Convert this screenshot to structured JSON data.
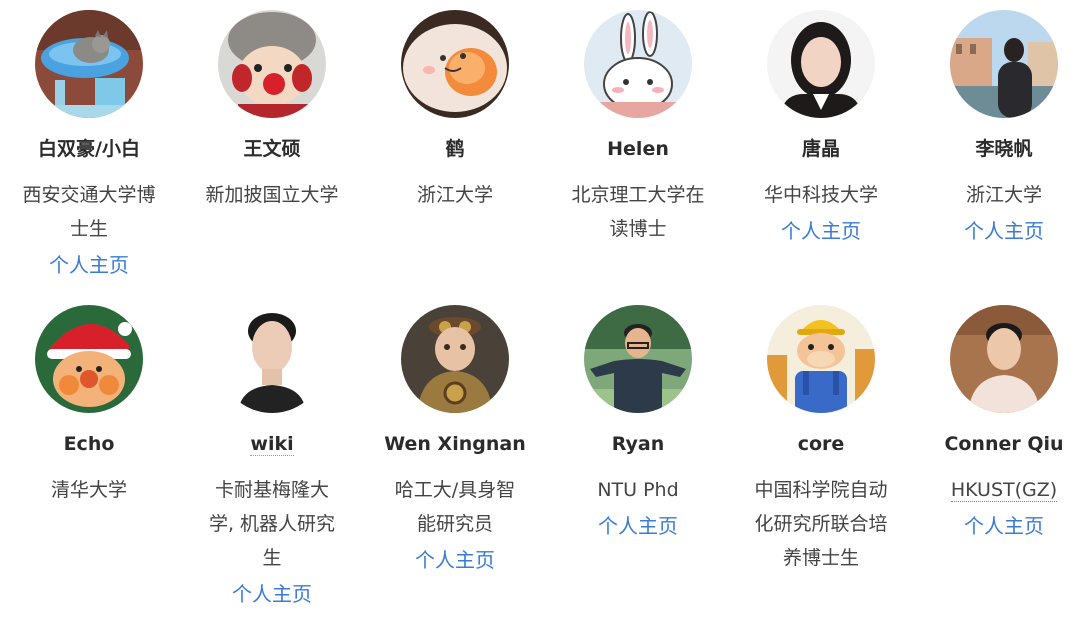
{
  "colors": {
    "link": "#3a7bd5",
    "name": "#2b2b2b",
    "desc": "#444444",
    "background": "#ffffff"
  },
  "members": [
    {
      "name": "白双豪/小白",
      "desc": "西安交通大学博\n士生",
      "link": "个人主页",
      "avatar_icon": "cat-avatar-icon"
    },
    {
      "name": "王文硕",
      "desc": "新加披国立大学",
      "link": "",
      "avatar_icon": "plush-toy-avatar-icon"
    },
    {
      "name": "鹤",
      "desc": "浙江大学",
      "link": "",
      "avatar_icon": "egg-yolk-avatar-icon"
    },
    {
      "name": "Helen",
      "desc": "北京理工大学在\n读博士",
      "link": "",
      "avatar_icon": "bunny-avatar-icon"
    },
    {
      "name": "唐晶",
      "desc": "华中科技大学",
      "link": "个人主页",
      "avatar_icon": "portrait-avatar-icon"
    },
    {
      "name": "李晓帆",
      "desc": "浙江大学",
      "link": "个人主页",
      "avatar_icon": "venice-photo-avatar-icon"
    },
    {
      "name": "Echo",
      "desc": "清华大学",
      "link": "",
      "avatar_icon": "anpanman-avatar-icon"
    },
    {
      "name": "wiki",
      "desc": "卡耐基梅隆大\n学, 机器人研究\n生",
      "link": "个人主页",
      "avatar_icon": "portrait-avatar-icon"
    },
    {
      "name": "Wen Xingnan",
      "desc": "哈工大/具身智\n能研究员",
      "link": "个人主页",
      "avatar_icon": "steampunk-robot-avatar-icon"
    },
    {
      "name": "Ryan",
      "desc": "NTU Phd",
      "link": "个人主页",
      "avatar_icon": "cartoon-man-avatar-icon"
    },
    {
      "name": "core",
      "desc": "中国科学院自动\n化研究所联合培\n养博士生",
      "link": "",
      "avatar_icon": "cartoon-bull-avatar-icon"
    },
    {
      "name": "Conner Qiu",
      "desc": "HKUST(GZ)",
      "link": "个人主页",
      "avatar_icon": "portrait-avatar-icon"
    }
  ]
}
